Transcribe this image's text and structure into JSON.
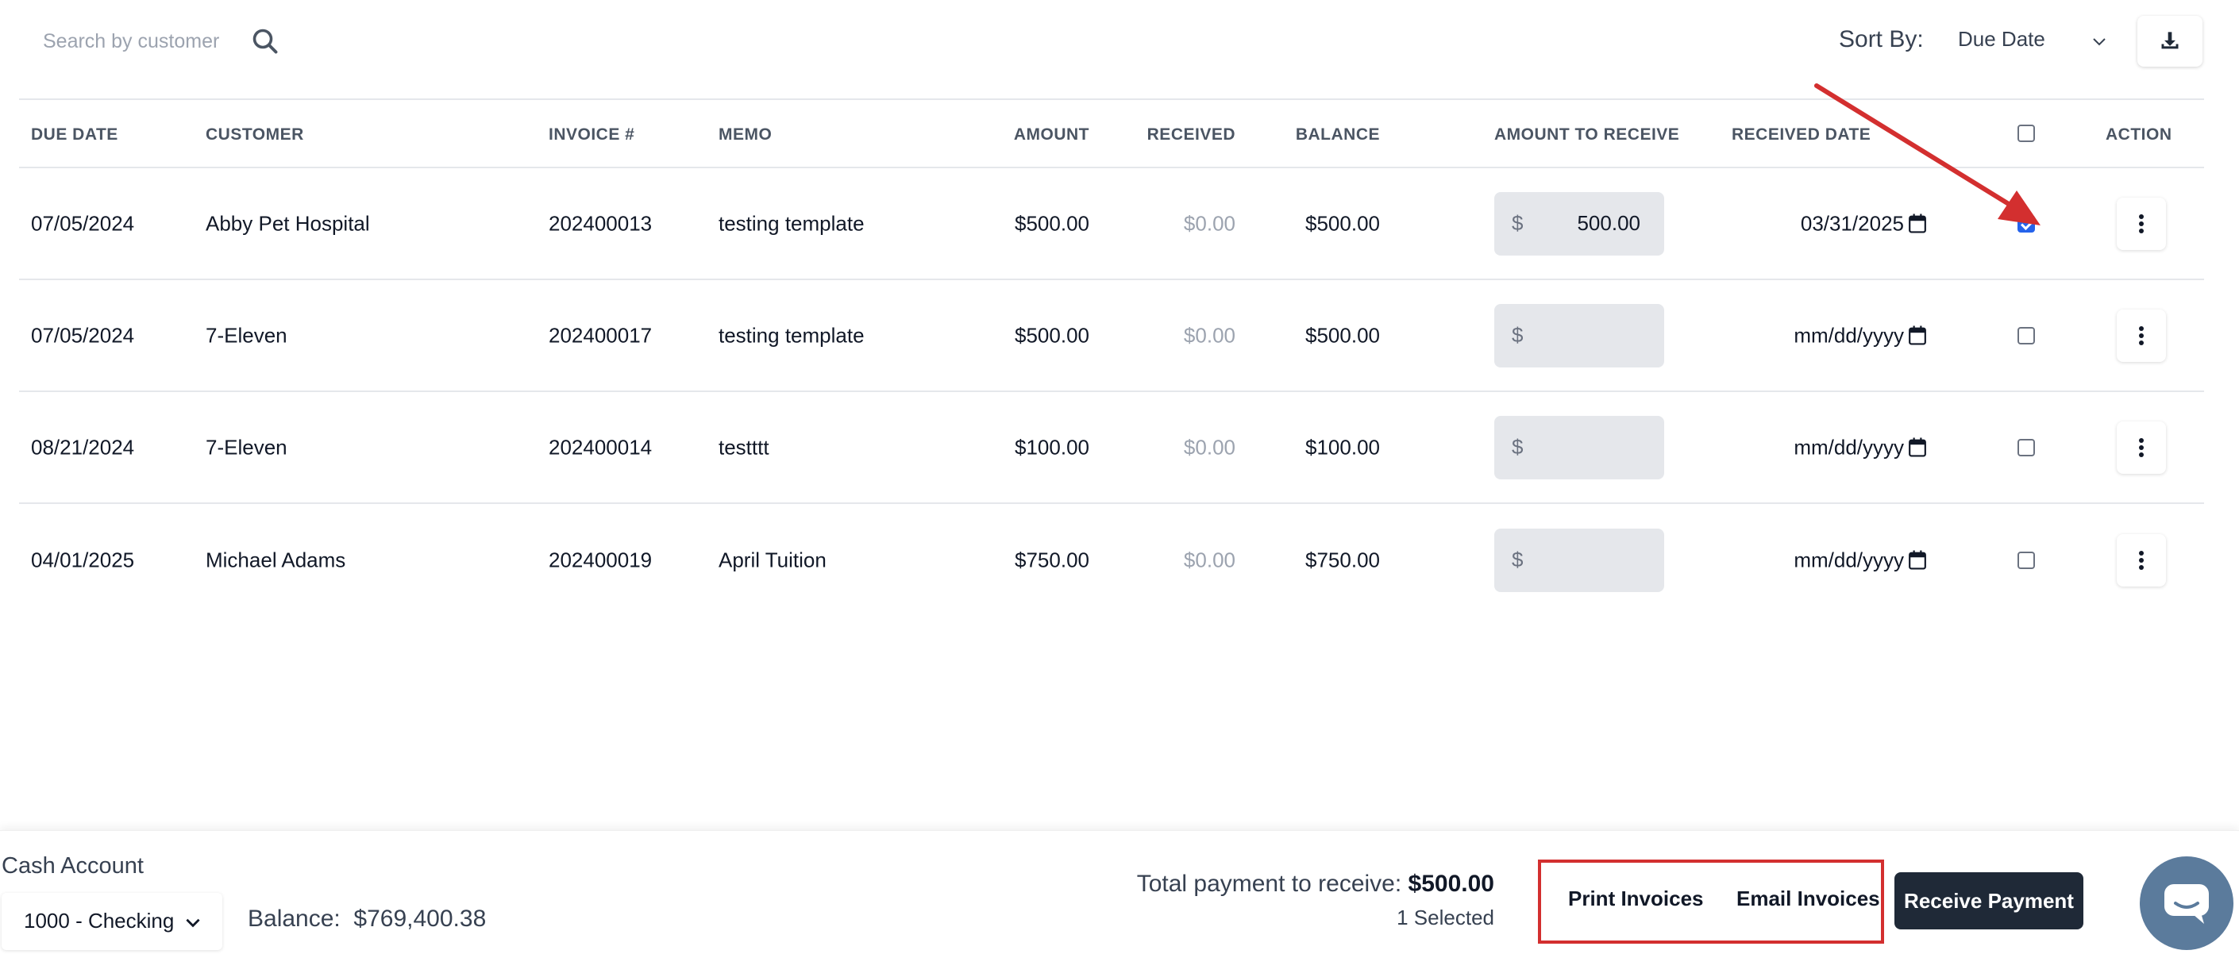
{
  "search": {
    "placeholder": "Search by customer"
  },
  "sort": {
    "label": "Sort By:",
    "value": "Due Date"
  },
  "table": {
    "headers": {
      "due_date": "DUE DATE",
      "customer": "CUSTOMER",
      "invoice": "INVOICE #",
      "memo": "MEMO",
      "amount": "AMOUNT",
      "received": "RECEIVED",
      "balance": "BALANCE",
      "amount_to_receive": "AMOUNT TO RECEIVE",
      "received_date": "RECEIVED DATE",
      "action": "ACTION"
    },
    "currency_symbol": "$",
    "rows": [
      {
        "due_date": "07/05/2024",
        "customer": "Abby Pet Hospital",
        "invoice": "202400013",
        "memo": "testing template",
        "amount": "$500.00",
        "received": "$0.00",
        "balance": "$500.00",
        "amount_to_receive": "500.00",
        "received_date": "03/31/2025",
        "checked": true
      },
      {
        "due_date": "07/05/2024",
        "customer": "7-Eleven",
        "invoice": "202400017",
        "memo": "testing template",
        "amount": "$500.00",
        "received": "$0.00",
        "balance": "$500.00",
        "amount_to_receive": "",
        "received_date": "mm/dd/yyyy",
        "checked": false
      },
      {
        "due_date": "08/21/2024",
        "customer": "7-Eleven",
        "invoice": "202400014",
        "memo": "testttt",
        "amount": "$100.00",
        "received": "$0.00",
        "balance": "$100.00",
        "amount_to_receive": "",
        "received_date": "mm/dd/yyyy",
        "checked": false
      },
      {
        "due_date": "04/01/2025",
        "customer": "Michael Adams",
        "invoice": "202400019",
        "memo": "April Tuition",
        "amount": "$750.00",
        "received": "$0.00",
        "balance": "$750.00",
        "amount_to_receive": "",
        "received_date": "mm/dd/yyyy",
        "checked": false
      }
    ]
  },
  "footer": {
    "cash_account_label": "Cash Account",
    "account_value": "1000 - Checking",
    "balance_label": "Balance:",
    "balance_value": "$769,400.38",
    "total_label": "Total payment to receive:",
    "total_value": "$500.00",
    "selected_count": "1 Selected",
    "print_label": "Print Invoices",
    "email_label": "Email Invoices",
    "receive_label": "Receive Payment"
  },
  "icons": {
    "search": "search-icon",
    "chevron": "chevron-down-icon",
    "download": "download-icon",
    "kebab": "kebab-menu-icon",
    "calendar": "calendar-icon",
    "chat": "chat-icon"
  },
  "colors": {
    "primary_button": "#1f2937",
    "checkbox_checked": "#2563eb",
    "annotation_red": "#d32f2f",
    "chat_bubble": "#5b7b9c",
    "input_bg": "#e5e7eb"
  }
}
